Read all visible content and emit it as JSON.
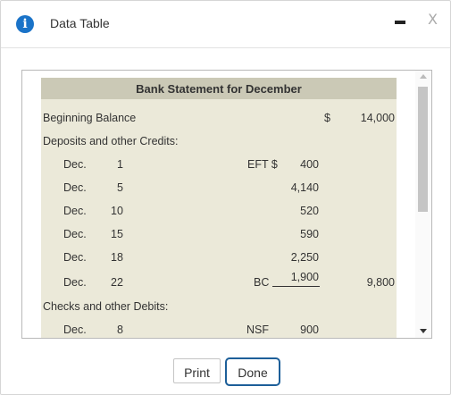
{
  "dialog": {
    "title": "Data Table",
    "info_glyph": "i",
    "close_glyph": "X",
    "icons": [
      "info-icon",
      "minimize-icon",
      "close-icon"
    ]
  },
  "statement": {
    "heading": "Bank Statement for December",
    "beginning_balance": {
      "label": "Beginning Balance",
      "currency": "$",
      "amount": "14,000"
    },
    "deposits_label": "Deposits and other Credits:",
    "deposits": [
      {
        "month": "Dec.",
        "day": "1",
        "code": "EFT $",
        "amount": "400"
      },
      {
        "month": "Dec.",
        "day": "5",
        "code": "",
        "amount": "4,140"
      },
      {
        "month": "Dec.",
        "day": "10",
        "code": "",
        "amount": "520"
      },
      {
        "month": "Dec.",
        "day": "15",
        "code": "",
        "amount": "590"
      },
      {
        "month": "Dec.",
        "day": "18",
        "code": "",
        "amount": "2,250"
      },
      {
        "month": "Dec.",
        "day": "22",
        "code": "BC",
        "amount": "1,900",
        "total": "9,800"
      }
    ],
    "checks_label": "Checks and other Debits:",
    "checks": [
      {
        "month": "Dec.",
        "day": "8",
        "code": "NSF",
        "amount": "900"
      }
    ]
  },
  "buttons": {
    "print": "Print",
    "done": "Done"
  },
  "colors": {
    "header_bg": "#cbc9b6",
    "table_bg": "#ebe9d9",
    "accent": "#1d5f99",
    "info": "#1a73c8"
  }
}
